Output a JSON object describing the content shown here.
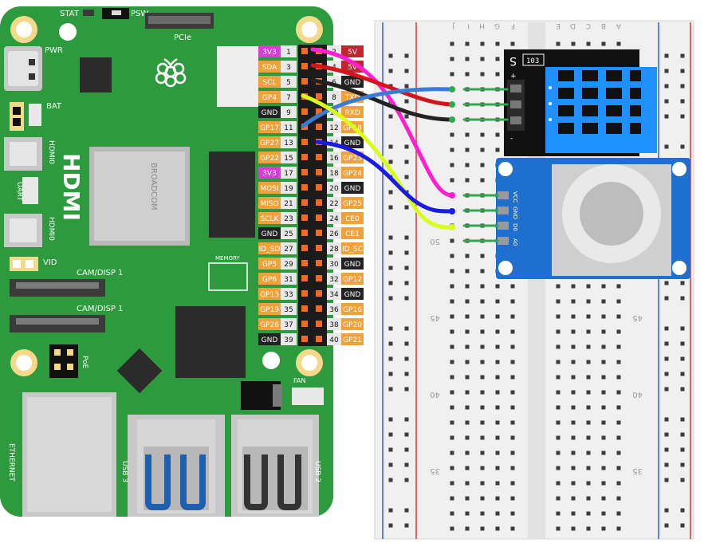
{
  "board": {
    "labels": {
      "stat": "STAT",
      "psw": "PSW",
      "pcie": "PCIe",
      "pwr": "PWR",
      "bat": "BAT",
      "hdmi0": "HDMI0",
      "hdmi1": "HDMI0",
      "hdmi_big": "HDMI",
      "uart": "UART",
      "vid": "VID",
      "cam1": "CAM/DISP 1",
      "cam2": "CAM/DISP 1",
      "memory": "MEMORY",
      "broadcom": "BROADCOM",
      "poe": "PoE",
      "fan": "FAN",
      "ethernet": "ETHERNET",
      "usb3": "USB 3",
      "usb2": "USB 2"
    },
    "colors": {
      "pcb": "#2d9b3d",
      "pcb_dark": "#1f7a2c"
    }
  },
  "gpio": {
    "left": [
      {
        "name": "3V3",
        "num": "1",
        "color": "#d63fd6"
      },
      {
        "name": "SDA",
        "num": "3",
        "color": "#f0a23a"
      },
      {
        "name": "SCL",
        "num": "5",
        "color": "#f0a23a"
      },
      {
        "name": "GP4",
        "num": "7",
        "color": "#f0a23a"
      },
      {
        "name": "GND",
        "num": "9",
        "color": "#222222"
      },
      {
        "name": "GP17",
        "num": "11",
        "color": "#f0a23a"
      },
      {
        "name": "GP27",
        "num": "13",
        "color": "#f0a23a"
      },
      {
        "name": "GP22",
        "num": "15",
        "color": "#f0a23a"
      },
      {
        "name": "3V3",
        "num": "17",
        "color": "#d63fd6"
      },
      {
        "name": "MOSI",
        "num": "19",
        "color": "#f0a23a"
      },
      {
        "name": "MISO",
        "num": "21",
        "color": "#f0a23a"
      },
      {
        "name": "SCLK",
        "num": "23",
        "color": "#f0a23a"
      },
      {
        "name": "GND",
        "num": "25",
        "color": "#222222"
      },
      {
        "name": "ID_SD",
        "num": "27",
        "color": "#f0a23a"
      },
      {
        "name": "GP5",
        "num": "29",
        "color": "#f0a23a"
      },
      {
        "name": "GP6",
        "num": "31",
        "color": "#f0a23a"
      },
      {
        "name": "GP13",
        "num": "33",
        "color": "#f0a23a"
      },
      {
        "name": "GP19",
        "num": "35",
        "color": "#f0a23a"
      },
      {
        "name": "GP26",
        "num": "37",
        "color": "#f0a23a"
      },
      {
        "name": "GND",
        "num": "39",
        "color": "#222222"
      }
    ],
    "right": [
      {
        "name": "5V",
        "num": "2",
        "color": "#c0272d"
      },
      {
        "name": "5V",
        "num": "4",
        "color": "#c0272d"
      },
      {
        "name": "GND",
        "num": "6",
        "color": "#222222"
      },
      {
        "name": "TXD",
        "num": "8",
        "color": "#f0a23a"
      },
      {
        "name": "RXD",
        "num": "10",
        "color": "#f0a23a"
      },
      {
        "name": "GP18",
        "num": "12",
        "color": "#f0a23a"
      },
      {
        "name": "GND",
        "num": "14",
        "color": "#222222"
      },
      {
        "name": "GP23",
        "num": "16",
        "color": "#f0a23a"
      },
      {
        "name": "GP24",
        "num": "18",
        "color": "#f0a23a"
      },
      {
        "name": "GND",
        "num": "20",
        "color": "#222222"
      },
      {
        "name": "GP25",
        "num": "22",
        "color": "#f0a23a"
      },
      {
        "name": "CE0",
        "num": "24",
        "color": "#f0a23a"
      },
      {
        "name": "CE1",
        "num": "26",
        "color": "#f0a23a"
      },
      {
        "name": "ID_SC",
        "num": "28",
        "color": "#f0a23a"
      },
      {
        "name": "GND",
        "num": "30",
        "color": "#222222"
      },
      {
        "name": "GP12",
        "num": "32",
        "color": "#f0a23a"
      },
      {
        "name": "GND",
        "num": "34",
        "color": "#222222"
      },
      {
        "name": "GP16",
        "num": "36",
        "color": "#f0a23a"
      },
      {
        "name": "GP20",
        "num": "38",
        "color": "#f0a23a"
      },
      {
        "name": "GP21",
        "num": "40",
        "color": "#f0a23a"
      }
    ]
  },
  "breadboard": {
    "col_letters_left": [
      "J",
      "I",
      "H",
      "G",
      "F"
    ],
    "col_letters_right": [
      "E",
      "D",
      "C",
      "B",
      "A"
    ],
    "row_numbers": [
      "50",
      "45",
      "40",
      "35"
    ]
  },
  "modules": {
    "dht": {
      "label": "S",
      "chip": "103",
      "pin_marks": [
        "+",
        "-"
      ]
    },
    "joystick": {
      "pins": [
        "VCC",
        "GND",
        "D0",
        "A0"
      ]
    }
  },
  "wires": [
    {
      "name": "pink",
      "color": "#ff1fd0"
    },
    {
      "name": "red",
      "color": "#d4141a"
    },
    {
      "name": "black",
      "color": "#222222"
    },
    {
      "name": "blue",
      "color": "#3a7bd5"
    },
    {
      "name": "yellow-green",
      "color": "#d8ff1a"
    },
    {
      "name": "dark-blue",
      "color": "#1a1ae6"
    },
    {
      "name": "teal",
      "color": "#1a8a6e"
    }
  ]
}
